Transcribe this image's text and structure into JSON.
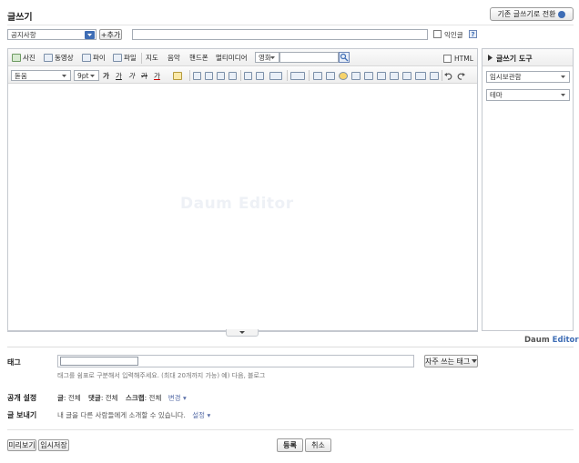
{
  "header": {
    "title": "글쓰기",
    "switch_button": "기존 글쓰기로 전환"
  },
  "category": {
    "selected": "공지사항",
    "add_button": "+추가"
  },
  "title_input": {
    "value": ""
  },
  "anonymous": {
    "label": "익인글",
    "help": "?"
  },
  "toolbar1": {
    "items": [
      "사진",
      "동영상",
      "파이",
      "파일",
      "지도",
      "음악",
      "핸드폰",
      "멀티미디어"
    ],
    "search_select": "영화",
    "html_label": "HTML"
  },
  "toolbar2": {
    "font": "돋움",
    "size": "9pt",
    "bold": "가",
    "underline": "가",
    "italic": "가",
    "strike": "가",
    "color": "가"
  },
  "side_panel": {
    "title": "글쓰기 도구",
    "select1": "임시보관함",
    "select2": "테마"
  },
  "editor": {
    "watermark": "Daum Editor"
  },
  "brand": {
    "daum": "Daum",
    "editor": "Editor"
  },
  "tag": {
    "label": "태그",
    "value": "",
    "frequent_button": "자주 쓰는 태그",
    "help": "태그를 쉼표로 구분해서 입력해주세요. (최대 20개까지 가능) 예) 다음, 블로그"
  },
  "public": {
    "label": "공개 설정",
    "post_key": "글",
    "post_val": ": 전체",
    "comment_key": "댓글",
    "comment_val": ": 전체",
    "scrap_key": "스크랩",
    "scrap_val": ": 전체",
    "change": "변경"
  },
  "send": {
    "label": "글 보내기",
    "text": "내 글을 다른 사람들에게 소개할 수 있습니다.",
    "setting": "설정"
  },
  "footer": {
    "preview": "미리보기",
    "draft": "임시저장",
    "submit": "등록",
    "cancel": "취소"
  },
  "colors": {
    "accent": "#3e6db5",
    "border": "#a5acb5",
    "panel_bg": "#f5f5f5"
  }
}
